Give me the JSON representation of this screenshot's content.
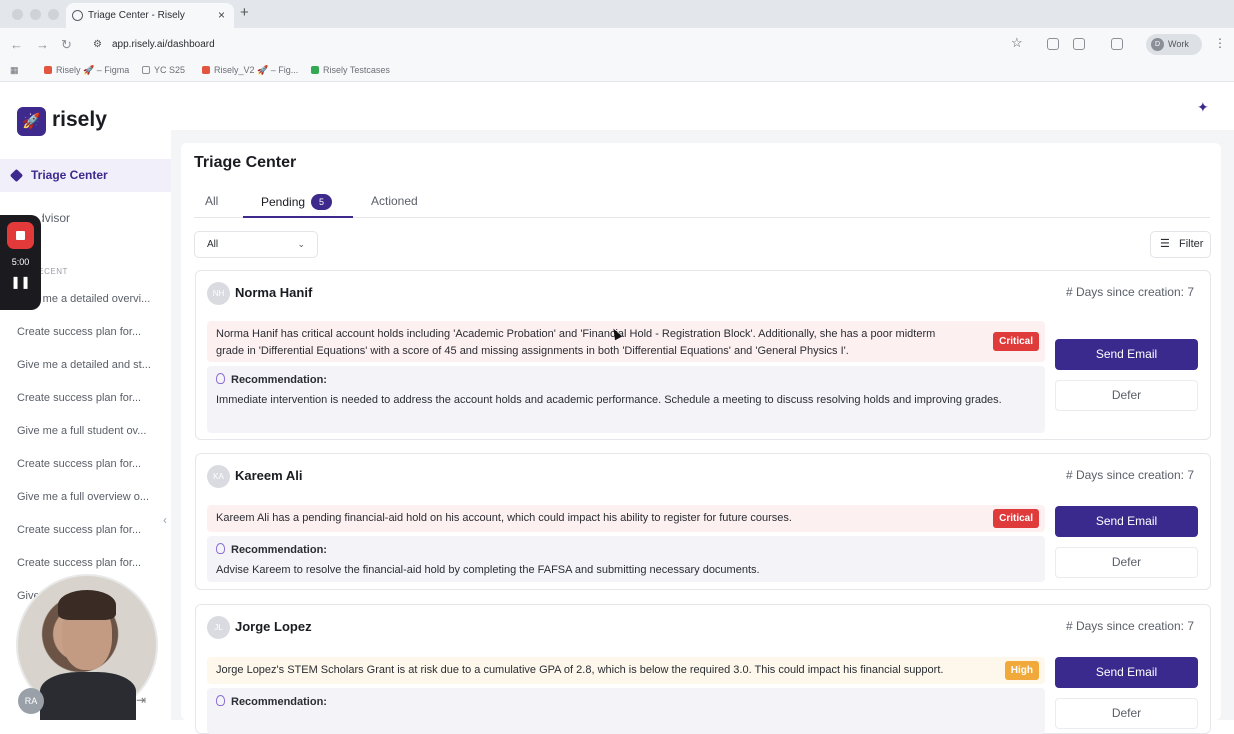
{
  "browser": {
    "tab_title": "Triage Center - Risely",
    "new_tab": "+",
    "close": "×",
    "url": "app.risely.ai/dashboard",
    "profile_initial": "D",
    "profile_name": "Work",
    "bookmarks": [
      {
        "label": "Risely 🚀 – Figma",
        "color": "#e2553e"
      },
      {
        "label": "YC S25",
        "color": "#8c9096"
      },
      {
        "label": "Risely_V2 🚀 – Fig...",
        "color": "#e2553e"
      },
      {
        "label": "Risely Testcases",
        "color": "#34a853"
      }
    ]
  },
  "sidebar": {
    "brand": "risely",
    "nav_active": "Triage Center",
    "nav_second": "AI Advisor",
    "recent_header": "RECENT",
    "recording": {
      "time": "5:00"
    },
    "history": [
      "Give me a detailed overvi...",
      "Create success plan for...",
      "Give me a detailed and st...",
      "Create success plan for...",
      "Give me a full student ov...",
      "Create success plan for...",
      "Give me a full overview o...",
      "Create success plan for...",
      "Create success plan for...",
      "Give..."
    ],
    "user_initials": "RA"
  },
  "main": {
    "title": "Triage Center",
    "tabs": {
      "all": "All",
      "pending": "Pending",
      "pending_count": "5",
      "actioned": "Actioned"
    },
    "select_value": "All",
    "filter_label": "Filter",
    "cards": [
      {
        "initials": "NH",
        "name": "Norma Hanif",
        "days": "# Days since creation: 7",
        "issue": "Norma Hanif has critical account holds including 'Academic Probation' and 'Financial Hold - Registration Block'. Additionally, she has a poor midterm grade in 'Differential Equations' with a score of 45 and missing assignments in both 'Differential Equations' and 'General Physics I'.",
        "severity": "Critical",
        "rec_label": "Recommendation:",
        "recommendation": "Immediate intervention is needed to address the account holds and academic performance. Schedule a meeting to discuss resolving holds and improving grades.",
        "send": "Send Email",
        "defer": "Defer"
      },
      {
        "initials": "KA",
        "name": "Kareem Ali",
        "days": "# Days since creation: 7",
        "issue": "Kareem Ali has a pending financial-aid hold on his account, which could impact his ability to register for future courses.",
        "severity": "Critical",
        "rec_label": "Recommendation:",
        "recommendation": "Advise Kareem to resolve the financial-aid hold by completing the FAFSA and submitting necessary documents.",
        "send": "Send Email",
        "defer": "Defer"
      },
      {
        "initials": "JL",
        "name": "Jorge Lopez",
        "days": "# Days since creation: 7",
        "issue": "Jorge Lopez's STEM Scholars Grant is at risk due to a cumulative GPA of 2.8, which is below the required 3.0. This could impact his financial support.",
        "severity": "High",
        "rec_label": "Recommendation:",
        "send": "Send Email",
        "defer": "Defer"
      }
    ]
  }
}
